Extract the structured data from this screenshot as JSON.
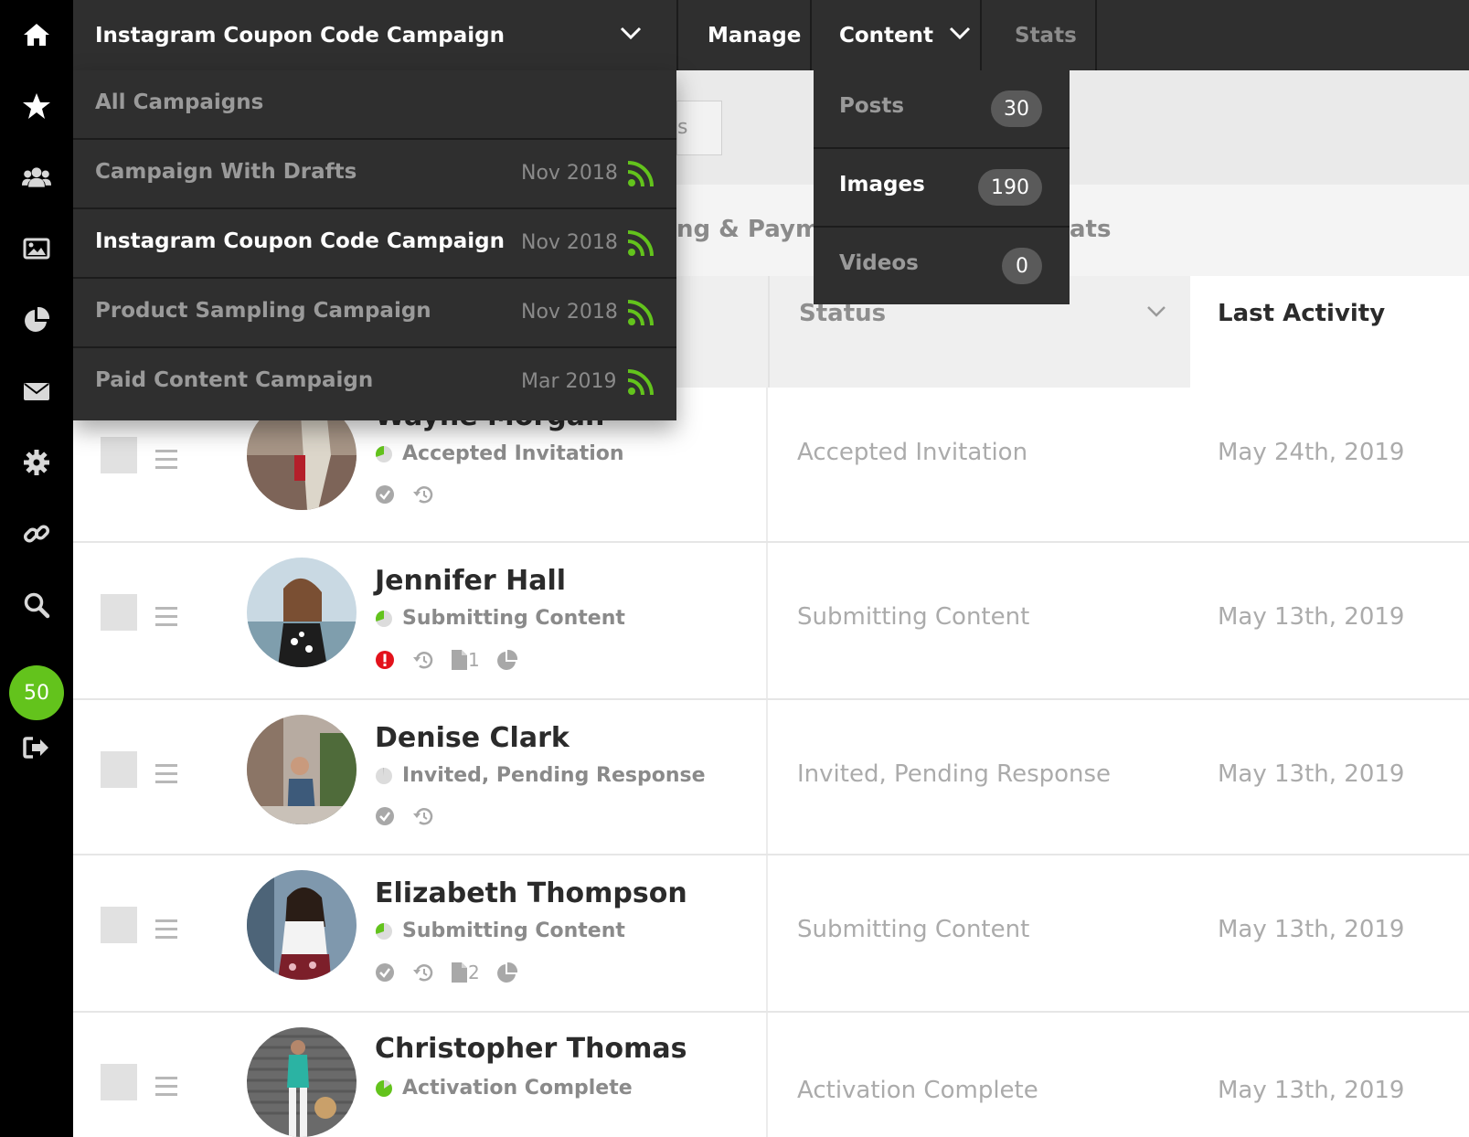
{
  "rail": {
    "items": [
      {
        "icon": "home-icon"
      },
      {
        "icon": "star-icon"
      },
      {
        "icon": "users-icon"
      },
      {
        "icon": "image-icon"
      },
      {
        "icon": "pie-chart-icon"
      },
      {
        "icon": "envelope-icon"
      },
      {
        "icon": "gear-icon"
      },
      {
        "icon": "link-icon"
      },
      {
        "icon": "search-icon"
      },
      {
        "icon": "signout-icon"
      }
    ],
    "badge": "50",
    "accent": "#63c31c"
  },
  "topbar": {
    "campaign_selector": "Instagram Coupon Code Campaign",
    "manage": "Manage",
    "content": "Content",
    "stats": "Stats"
  },
  "background": {
    "search_peek": "s",
    "tab_peek_left": "ng & Payme",
    "tab_peek_right": "ats"
  },
  "campaign_dropdown": {
    "items": [
      {
        "name": "All Campaigns",
        "date": "",
        "active": false,
        "rss": false
      },
      {
        "name": "Campaign With Drafts",
        "date": "Nov 2018",
        "active": false,
        "rss": true
      },
      {
        "name": "Instagram Coupon Code Campaign",
        "date": "Nov 2018",
        "active": true,
        "rss": true
      },
      {
        "name": "Product Sampling Campaign",
        "date": "Nov 2018",
        "active": false,
        "rss": true
      },
      {
        "name": "Paid Content Campaign",
        "date": "Mar 2019",
        "active": false,
        "rss": true
      }
    ]
  },
  "content_dropdown": {
    "items": [
      {
        "name": "Posts",
        "count": "30",
        "active": false
      },
      {
        "name": "Images",
        "count": "190",
        "active": true
      },
      {
        "name": "Videos",
        "count": "0",
        "active": false
      }
    ]
  },
  "table": {
    "headers": {
      "status": "Status",
      "last_activity": "Last Activity"
    },
    "rows": [
      {
        "name": "Wayne Morgan",
        "status": "Accepted Invitation",
        "status_col": "Accepted Invitation",
        "date": "May 24th, 2019",
        "icons": [
          "check-circle-icon",
          "history-icon"
        ],
        "file_count": "",
        "alert": false
      },
      {
        "name": "Jennifer Hall",
        "status": "Submitting Content",
        "status_col": "Submitting Content",
        "date": "May 13th, 2019",
        "icons": [
          "alert-icon",
          "history-icon",
          "file-icon",
          "pie-icon"
        ],
        "file_count": "1",
        "alert": true
      },
      {
        "name": "Denise Clark",
        "status": "Invited, Pending Response",
        "status_col": "Invited, Pending Response",
        "date": "May 13th, 2019",
        "icons": [
          "check-circle-icon",
          "history-icon"
        ],
        "file_count": "",
        "alert": false
      },
      {
        "name": "Elizabeth Thompson",
        "status": "Submitting Content",
        "status_col": "Submitting Content",
        "date": "May 13th, 2019",
        "icons": [
          "check-circle-icon",
          "history-icon",
          "file-icon",
          "pie-icon"
        ],
        "file_count": "2",
        "alert": false
      },
      {
        "name": "Christopher Thomas",
        "status": "Activation Complete",
        "status_col": "Activation Complete",
        "date": "May 13th, 2019",
        "icons": [
          "check-circle-icon",
          "history-icon",
          "file-icon",
          "pie-icon"
        ],
        "file_count": "",
        "alert": false
      }
    ]
  }
}
